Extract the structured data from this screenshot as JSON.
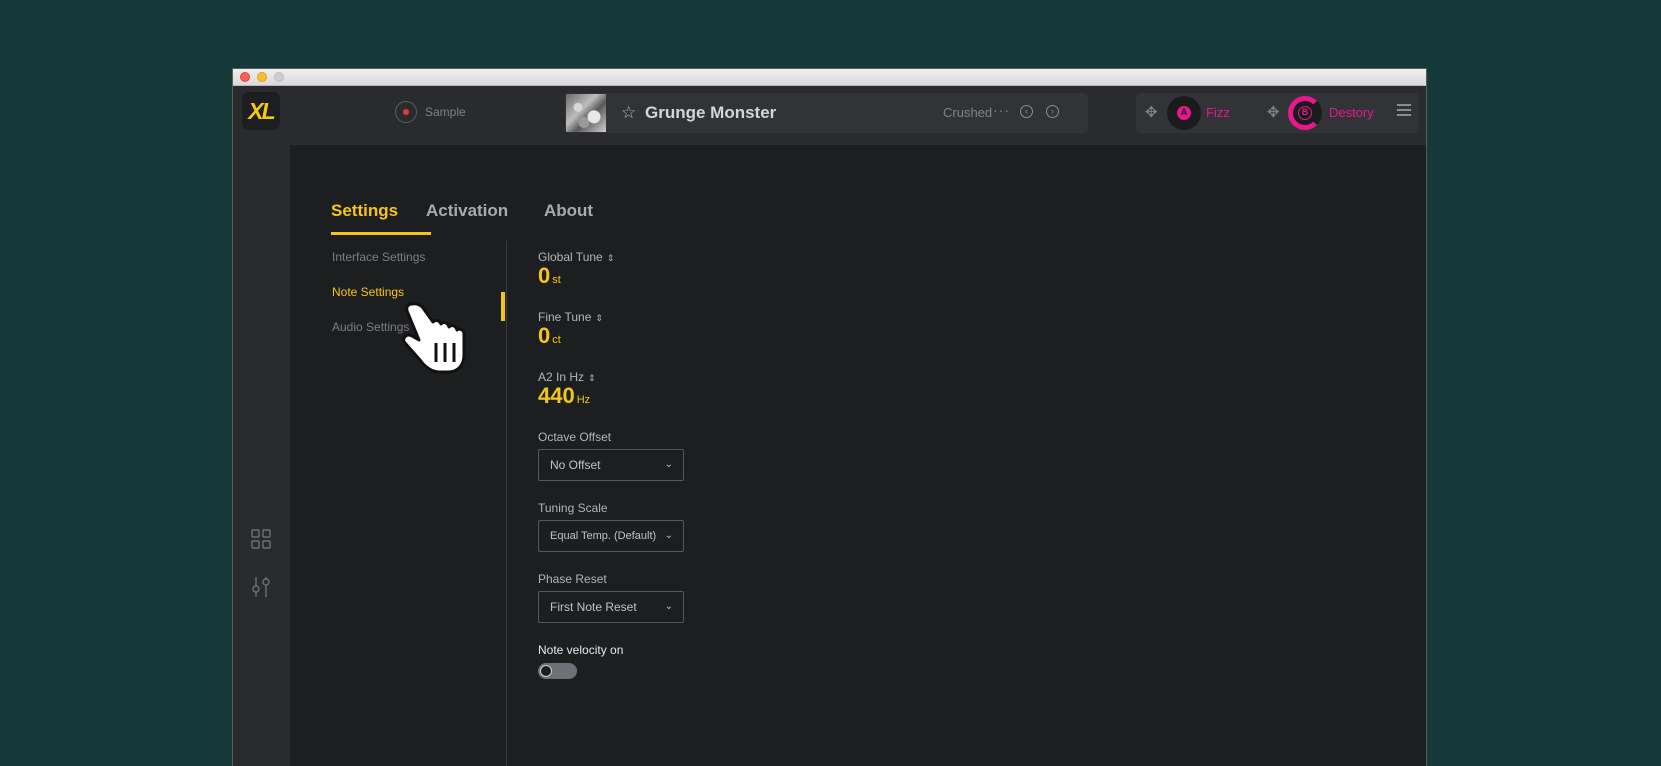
{
  "logo": "XL",
  "record": {
    "label": "Sample"
  },
  "preset": {
    "name": "Grunge Monster",
    "tag": "Crushed",
    "more": "···"
  },
  "fx_slots": [
    {
      "letter": "A",
      "label": "Fizz"
    },
    {
      "letter": "B",
      "label": "Destory"
    }
  ],
  "tabs": [
    {
      "label": "Settings",
      "active": true
    },
    {
      "label": "Activation",
      "active": false
    },
    {
      "label": "About",
      "active": false
    }
  ],
  "subnav": [
    {
      "label": "Interface Settings"
    },
    {
      "label": "Note Settings"
    },
    {
      "label": "Audio Settings"
    }
  ],
  "settings": {
    "global_tune": {
      "label": "Global Tune",
      "value": "0",
      "unit": "st"
    },
    "fine_tune": {
      "label": "Fine Tune",
      "value": "0",
      "unit": "ct"
    },
    "a2_hz": {
      "label": "A2 In Hz",
      "value": "440",
      "unit": "Hz"
    },
    "octave_offset": {
      "label": "Octave Offset",
      "value": "No Offset"
    },
    "tuning_scale": {
      "label": "Tuning Scale",
      "value": "Equal Temp. (Default)"
    },
    "phase_reset": {
      "label": "Phase Reset",
      "value": "First Note Reset"
    },
    "note_velocity": {
      "label": "Note velocity on",
      "on": false
    }
  },
  "colors": {
    "accent": "#f5c518",
    "fx": "#e8188c",
    "background": "#153839"
  }
}
